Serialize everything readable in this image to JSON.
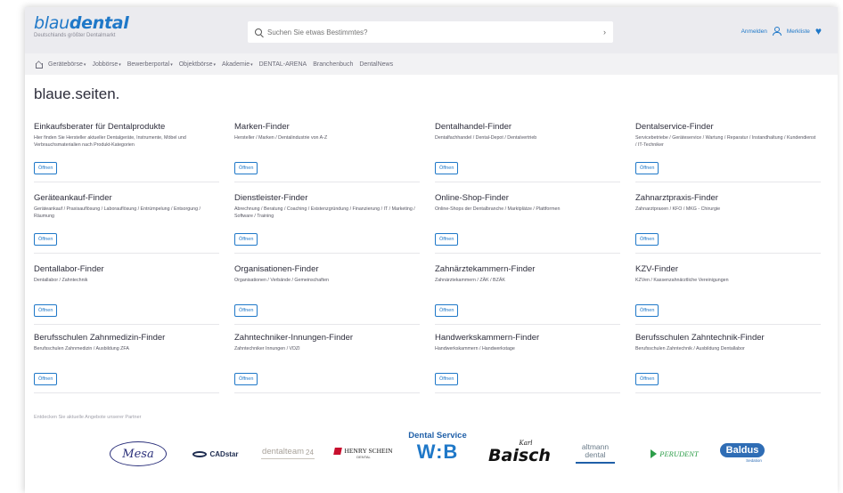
{
  "header": {
    "logo_main": "blau",
    "logo_bold": "dental",
    "tagline": "Deutschlands größter Dentalmarkt",
    "search_placeholder": "Suchen Sie etwas Bestimmtes?",
    "search_arrow": "›",
    "login_label": "Anmelden",
    "wishlist_label": "Merkliste"
  },
  "nav": {
    "items": [
      {
        "label": "Gerätebörse",
        "has_caret": true
      },
      {
        "label": "Jobbörse",
        "has_caret": true
      },
      {
        "label": "Bewerberportal",
        "has_caret": true
      },
      {
        "label": "Objektbörse",
        "has_caret": true
      },
      {
        "label": "Akademie",
        "has_caret": true
      },
      {
        "label": "DENTAL-ARENA",
        "has_caret": false
      },
      {
        "label": "Branchenbuch",
        "has_caret": false
      },
      {
        "label": "DentalNews",
        "has_caret": false
      }
    ],
    "caret": "▾"
  },
  "page_title": "blaue.seiten.",
  "open_label": "Öffnen",
  "cards": [
    {
      "title": "Einkaufsberater für Dentalprodukte",
      "desc": "Hier finden Sie Hersteller aktueller Dentalgeräte, Instrumente, Möbel und Verbrauchsmaterialien nach Produkt-Kategorien"
    },
    {
      "title": "Marken-Finder",
      "desc": "Hersteller / Marken / Dentalindustrie von A-Z"
    },
    {
      "title": "Dentalhandel-Finder",
      "desc": "Dentalfachhandel / Dental-Depot / Dentalvertrieb"
    },
    {
      "title": "Dentalservice-Finder",
      "desc": "Servicebetriebe / Geräteservice / Wartung / Reparatur / Instandhaltung / Kundendienst / IT-Techniker"
    },
    {
      "title": "Geräteankauf-Finder",
      "desc": "Geräteankauf / Praxisauflösung / Laborauflösung / Entrümpelung / Entsorgung / Räumung"
    },
    {
      "title": "Dienstleister-Finder",
      "desc": "Abrechnung / Beratung / Coaching / Existenzgründung / Finanzierung / IT / Marketing / Software / Training"
    },
    {
      "title": "Online-Shop-Finder",
      "desc": "Online-Shops der Dentalbranche / Marktplätze / Plattformen"
    },
    {
      "title": "Zahnarztpraxis-Finder",
      "desc": "Zahnarztpraxen / KFO / MKG - Chirurgie"
    },
    {
      "title": "Dentallabor-Finder",
      "desc": "Dentallabor / Zahntechnik"
    },
    {
      "title": "Organisationen-Finder",
      "desc": "Organisationen / Verbände / Gemeinschaften"
    },
    {
      "title": "Zahnärztekammern-Finder",
      "desc": "Zahnärztekammern / ZÄK / BZÄK"
    },
    {
      "title": "KZV-Finder",
      "desc": "KZVen / Kassenzahnärztliche Vereinigungen"
    },
    {
      "title": "Berufsschulen Zahnmedizin-Finder",
      "desc": "Berufsschulen Zahnmedizin / Ausbildung ZFA"
    },
    {
      "title": "Zahntechniker-Innungen-Finder",
      "desc": "Zahntechniker Innungen / VDZI"
    },
    {
      "title": "Handwerkskammern-Finder",
      "desc": "Handwerkskammern / Handwerkstage"
    },
    {
      "title": "Berufsschulen Zahntechnik-Finder",
      "desc": "Berufsschulen Zahntechnik / Ausbildung Dentallabor"
    }
  ],
  "partners_text": "Entdecken Sie aktuelle Angebote unserer Partner",
  "partners": {
    "mesa": "Mesa",
    "cadstar": "CADstar",
    "dentalteam": "dentalteam",
    "dentalteam_num": "24",
    "henryschein": "HENRY SCHEIN",
    "henryschein_sub": "DENTAL",
    "wb_top": "Dental Service",
    "wb_main": "W:B",
    "baisch_small": "Karl",
    "baisch": "Baisch",
    "altmann_1": "altmann",
    "altmann_2": "dental",
    "perudent": "PERUDENT",
    "baldus": "Baldus",
    "baldus_sub": "Sedation"
  },
  "colors": {
    "brand": "#1f78c8",
    "header_bg": "#ebebef",
    "nav_bg": "#f2f2f4"
  }
}
